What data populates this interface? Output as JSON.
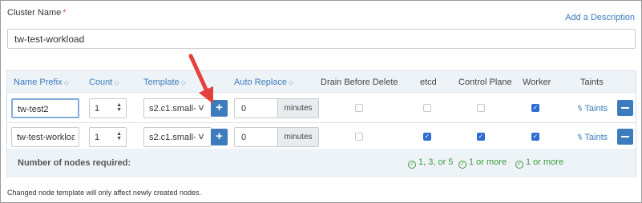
{
  "cluster": {
    "name_label": "Cluster Name",
    "required_mark": "*",
    "add_description_label": "Add a Description",
    "name_value": "tw-test-workload"
  },
  "columns": {
    "name_prefix": "Name Prefix",
    "count": "Count",
    "template": "Template",
    "auto_replace": "Auto Replace",
    "drain": "Drain Before Delete",
    "etcd": "etcd",
    "control_plane": "Control Plane",
    "worker": "Worker",
    "taints": "Taints",
    "sort_icon": "sort-icon"
  },
  "rows": [
    {
      "name_prefix": "tw-test2",
      "count": "1",
      "template": "s2.c1.small-",
      "auto_replace": "0",
      "auto_replace_unit": "minutes",
      "drain": false,
      "etcd": false,
      "control_plane": false,
      "worker": true,
      "taints_label": "Taints"
    },
    {
      "name_prefix": "tw-test-workload-",
      "count": "1",
      "template": "s2.c1.small-",
      "auto_replace": "0",
      "auto_replace_unit": "minutes",
      "drain": false,
      "etcd": true,
      "control_plane": true,
      "worker": true,
      "taints_label": "Taints"
    }
  ],
  "footer": {
    "label": "Number of nodes required:",
    "etcd_req": "1, 3, or 5",
    "control_plane_req": "1 or more",
    "worker_req": "1 or more"
  },
  "note": "Changed node template will only affect newly created nodes.",
  "colors": {
    "accent": "#3d7bbd",
    "checkbox_on": "#2d6cd1",
    "ok_green": "#3f9b3c",
    "annotation_arrow": "#e5413c"
  }
}
